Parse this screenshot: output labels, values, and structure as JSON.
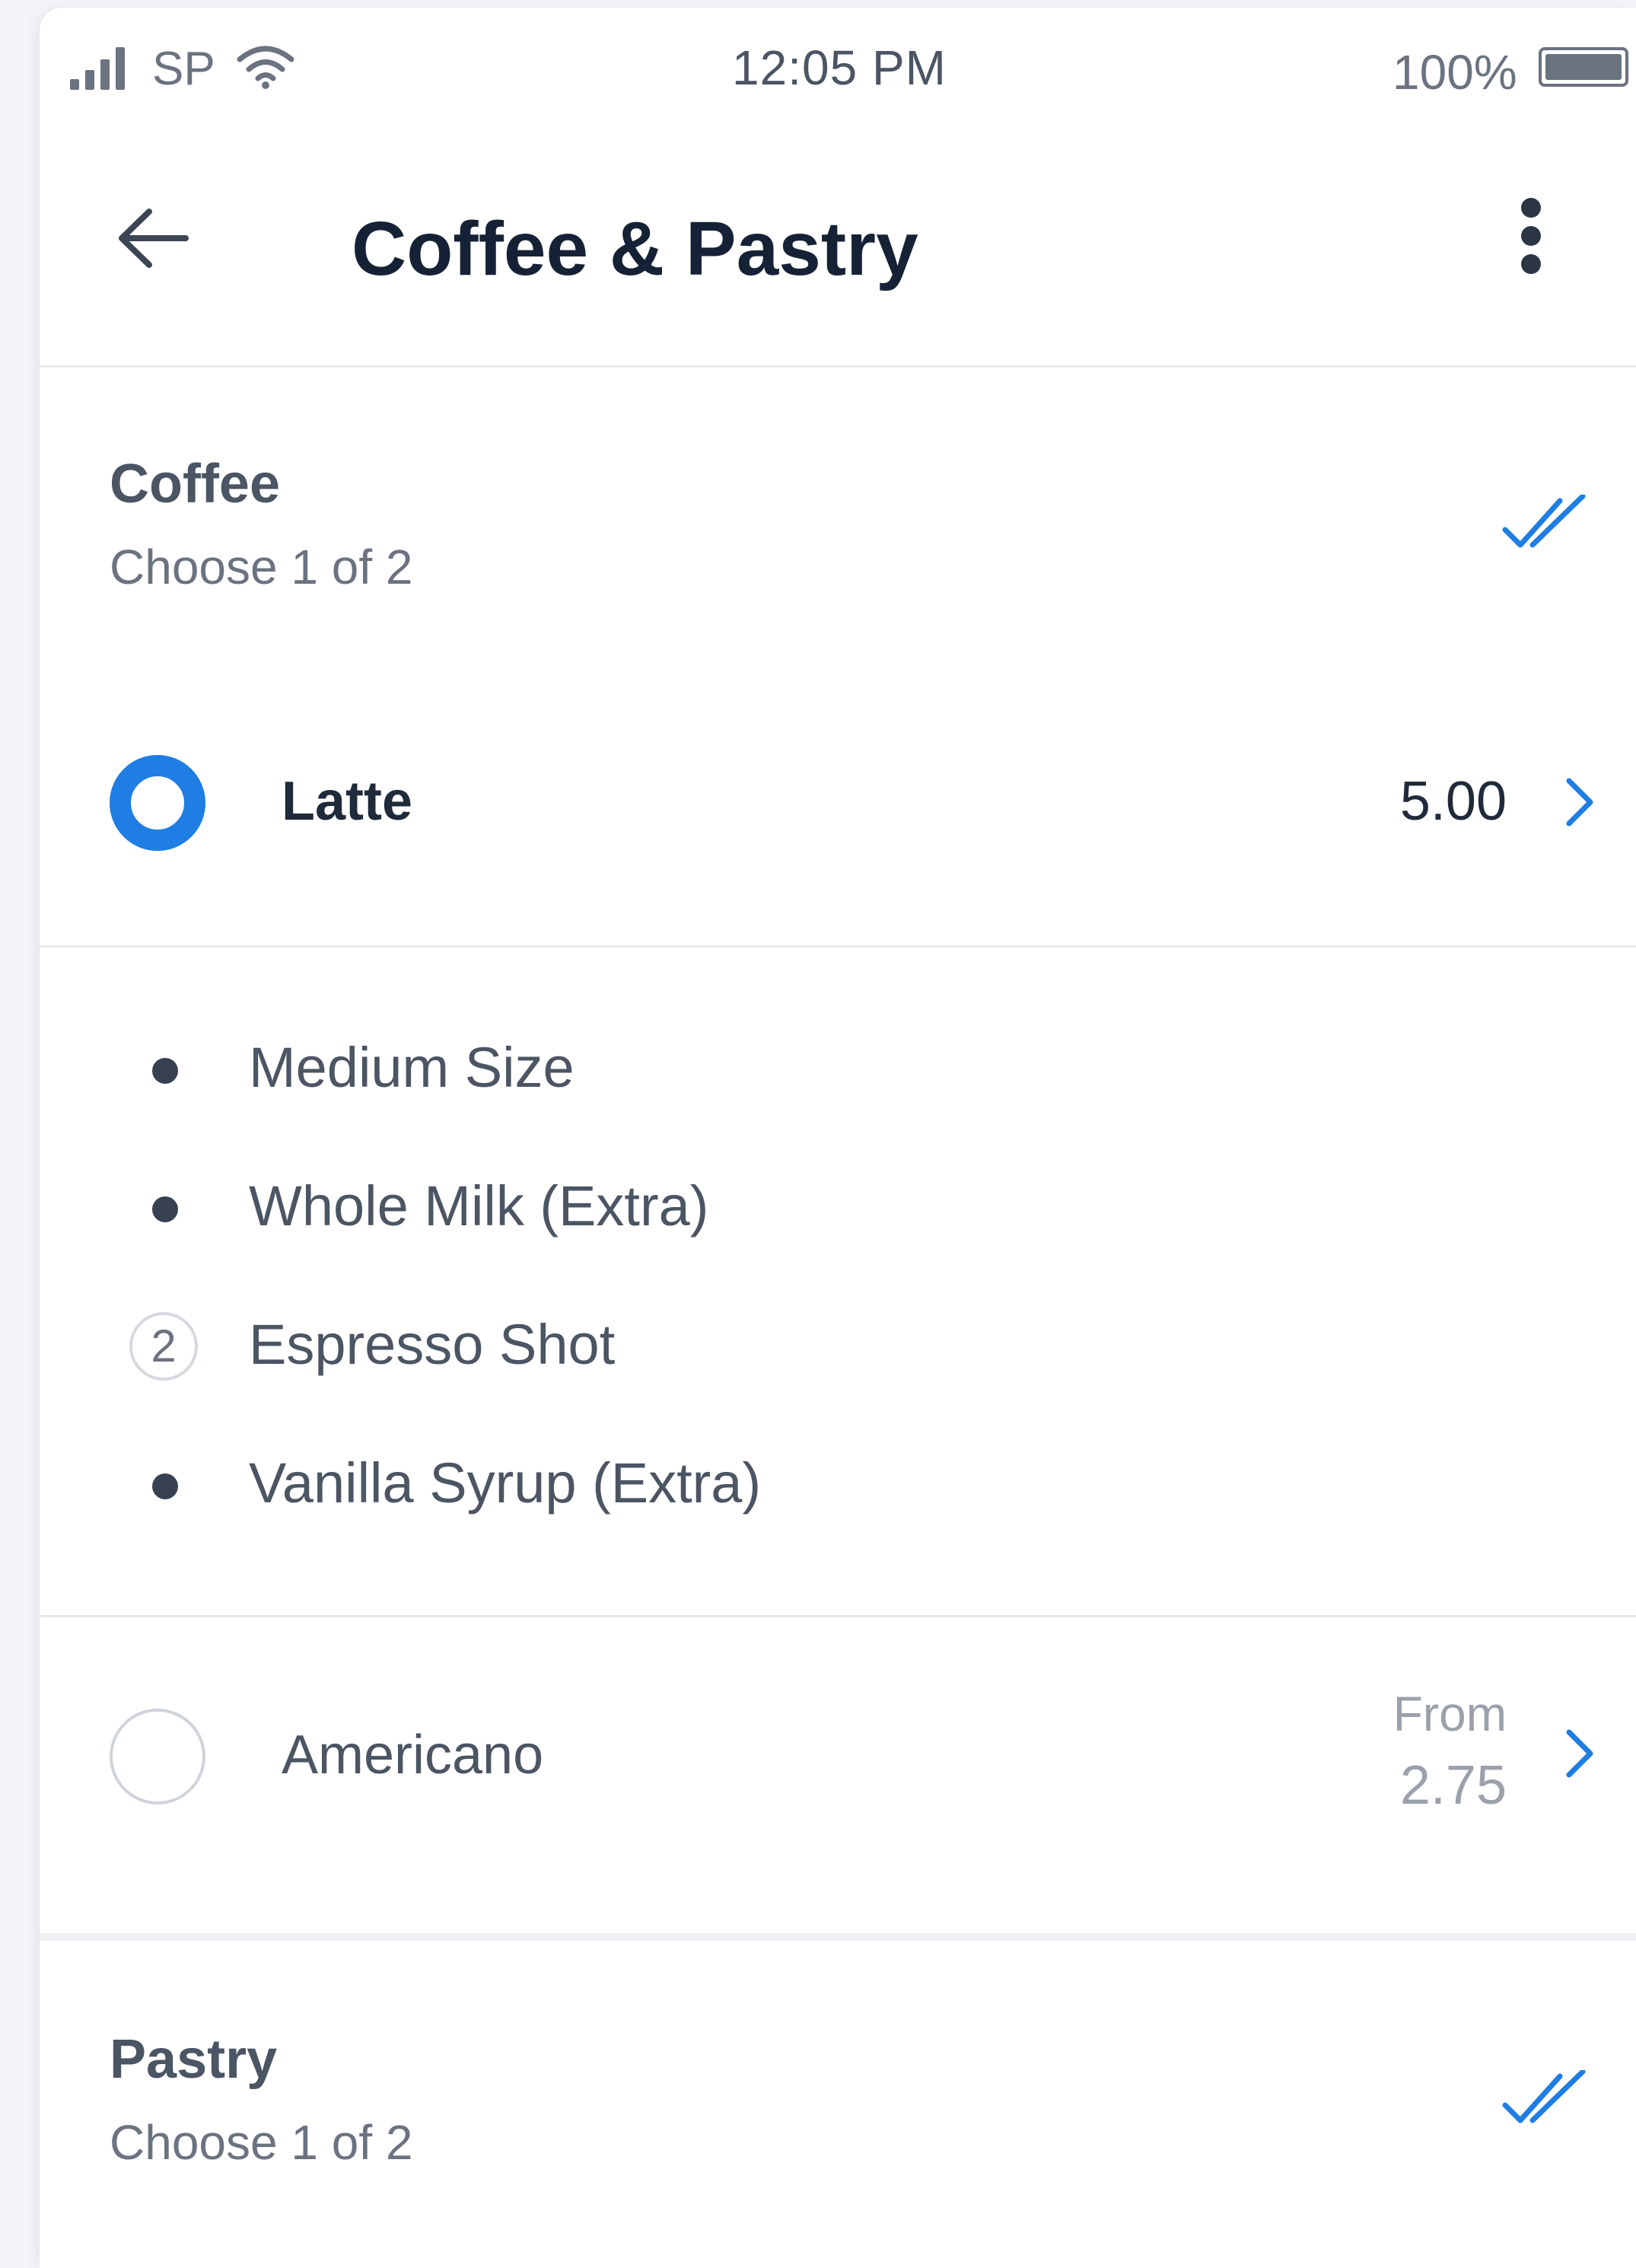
{
  "status_bar": {
    "carrier": "SP",
    "time": "12:05 PM",
    "battery": "100%"
  },
  "header": {
    "title": "Coffee & Pastry"
  },
  "sections": [
    {
      "title": "Coffee",
      "subtitle": "Choose 1 of 2",
      "items": [
        {
          "name": "Latte",
          "price": "5.00",
          "selected": true,
          "options": [
            {
              "label": "Medium Size",
              "count": null
            },
            {
              "label": "Whole Milk (Extra)",
              "count": null
            },
            {
              "label": "Espresso Shot",
              "count": "2"
            },
            {
              "label": "Vanilla Syrup (Extra)",
              "count": null
            }
          ]
        },
        {
          "name": "Americano",
          "price_prefix": "From",
          "price": "2.75",
          "selected": false
        }
      ]
    },
    {
      "title": "Pastry",
      "subtitle": "Choose 1 of 2"
    }
  ],
  "colors": {
    "accent": "#1f7de4",
    "title": "#152236",
    "muted": "#6b7280"
  },
  "icons": {
    "back": "arrow-left-icon",
    "more": "more-vertical-icon",
    "check": "double-check-icon",
    "chevron": "chevron-right-icon"
  }
}
